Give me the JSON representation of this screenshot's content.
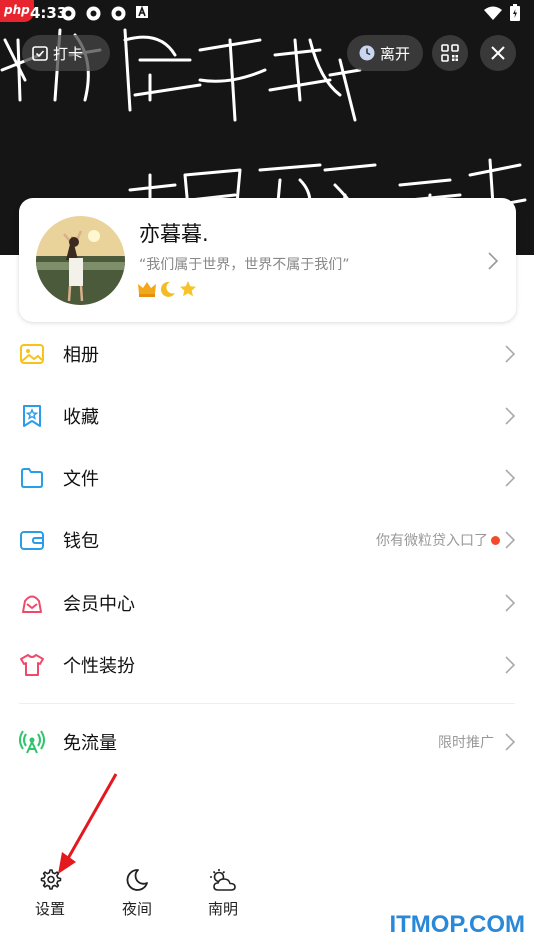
{
  "status_bar": {
    "time": "4:33"
  },
  "header": {
    "checkin_label": "打卡",
    "leave_label": "离开"
  },
  "profile": {
    "name": "亦暮暮.",
    "signature": "“我们属于世界，世界不属于我们”",
    "badges": [
      "crown-icon",
      "moon-icon",
      "star-icon"
    ]
  },
  "menu": {
    "items": [
      {
        "label": "相册",
        "icon": "album-icon",
        "color": "#f6c31c"
      },
      {
        "label": "收藏",
        "icon": "favorites-icon",
        "color": "#2b9de8"
      },
      {
        "label": "文件",
        "icon": "folder-icon",
        "color": "#2b9de8"
      },
      {
        "label": "钱包",
        "icon": "wallet-icon",
        "color": "#2b9de8",
        "hint": "你有微粒贷入口了"
      },
      {
        "label": "会员中心",
        "icon": "vip-icon",
        "color": "#f04a6a"
      },
      {
        "label": "个性装扮",
        "icon": "tshirt-icon",
        "color": "#f04a6a"
      },
      {
        "label": "免流量",
        "icon": "antenna-icon",
        "color": "#2ec46a",
        "hint": "限时推广"
      }
    ]
  },
  "bottom": {
    "settings_label": "设置",
    "night_label": "夜间",
    "weather_label": "南明"
  },
  "watermark": "ITMOP.COM",
  "site_logo": "php"
}
